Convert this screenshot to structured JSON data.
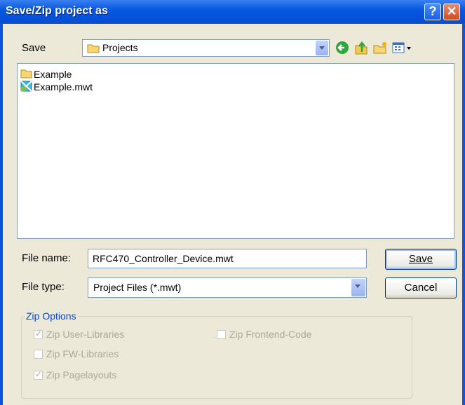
{
  "window": {
    "title": "Save/Zip project as",
    "help_glyph": "?",
    "close_glyph": "✕"
  },
  "save_in": {
    "label": "Save",
    "folder_name": "Projects",
    "folder_icon": "folder-icon"
  },
  "toolbar": {
    "back_icon": "back-arrow-icon",
    "up_icon": "up-folder-icon",
    "new_folder_icon": "new-folder-icon",
    "views_icon": "views-menu-icon"
  },
  "files": [
    {
      "name": "Example",
      "icon": "folder-icon"
    },
    {
      "name": "Example.mwt",
      "icon": "mwt-file-icon"
    }
  ],
  "file_name": {
    "label": "File name:",
    "value": "RFC470_Controller_Device.mwt"
  },
  "file_type": {
    "label": "File type:",
    "value": "Project Files (*.mwt)"
  },
  "buttons": {
    "save": "Save",
    "cancel": "Cancel"
  },
  "zip_options": {
    "legend": "Zip Options",
    "user_libraries": {
      "label": "Zip User-Libraries",
      "checked": true
    },
    "fw_libraries": {
      "label": "Zip FW-Libraries",
      "checked": false
    },
    "pagelayouts": {
      "label": "Zip Pagelayouts",
      "checked": true
    },
    "frontend_code": {
      "label": "Zip Frontend-Code",
      "checked": false
    }
  },
  "colors": {
    "titlebar": "#0858E0",
    "dialog_bg": "#ECE9D8",
    "disabled_text": "#ACA899",
    "legend_text": "#0046D5"
  }
}
